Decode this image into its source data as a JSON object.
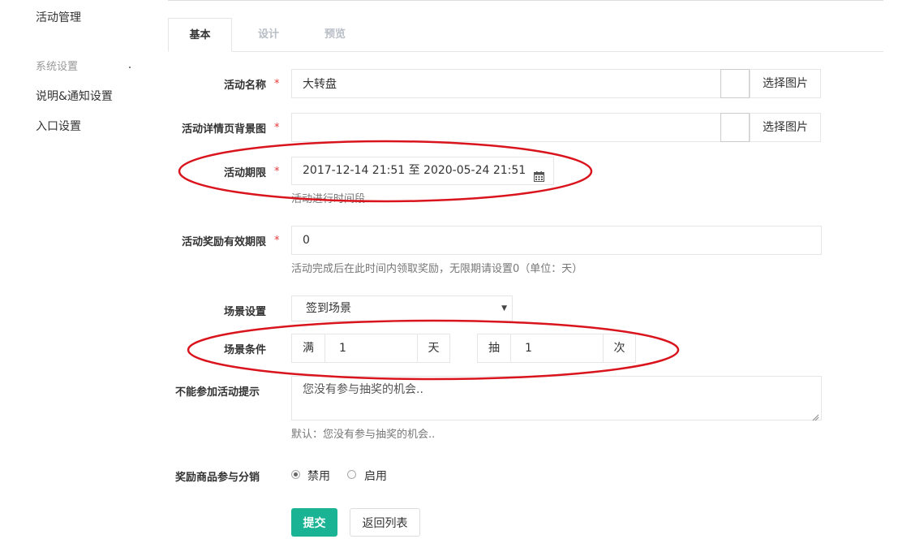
{
  "sidebar": {
    "top_item": "活动管理",
    "group_label": "系统设置",
    "items": [
      {
        "label": "说明&通知设置"
      },
      {
        "label": "入口设置"
      }
    ]
  },
  "tabs": [
    {
      "label": "基本",
      "active": true
    },
    {
      "label": "设计",
      "active": false
    },
    {
      "label": "预览",
      "active": false
    }
  ],
  "form": {
    "required_mark": "*",
    "name": {
      "label": "活动名称",
      "value": "大转盘",
      "pick_button": "选择图片"
    },
    "bg_image": {
      "label": "活动详情页背景图",
      "value": "",
      "pick_button": "选择图片"
    },
    "period": {
      "label": "活动期限",
      "value": "2017-12-14 21:51 至 2020-05-24 21:51",
      "help": "活动进行时间段",
      "icon": "calendar-icon"
    },
    "reward_validity": {
      "label": "活动奖励有效期限",
      "value": "0",
      "help": "活动完成后在此时间内领取奖励，无限期请设置0（单位：天）"
    },
    "scene": {
      "label": "场景设置",
      "selected": "签到场景"
    },
    "scene_condition": {
      "label": "场景条件",
      "days_prefix": "满",
      "days_value": "1",
      "days_suffix": "天",
      "draw_prefix": "抽",
      "draw_value": "1",
      "draw_suffix": "次"
    },
    "cannot_join_tip": {
      "label": "不能参加活动提示",
      "placeholder": "您没有参与抽奖的机会..",
      "help": "默认：您没有参与抽奖的机会.."
    },
    "distribution": {
      "label": "奖励商品参与分销",
      "options": [
        {
          "label": "禁用",
          "checked": true
        },
        {
          "label": "启用",
          "checked": false
        }
      ]
    },
    "submit_label": "提交",
    "back_label": "返回列表"
  },
  "colors": {
    "primary": "#1ab394",
    "required": "#e4393c",
    "annotation": "#d9141c"
  }
}
